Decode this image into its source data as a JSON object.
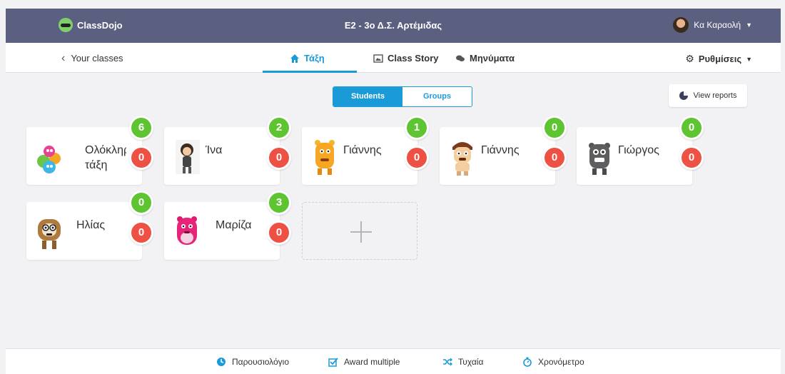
{
  "header": {
    "logo_text": "ClassDojo",
    "class_title": "E2 - 3ο Δ.Σ. Αρτέμιδας",
    "user_name": "Κα Καραολή"
  },
  "nav": {
    "back_label": "Your classes",
    "tabs": [
      {
        "label": "Τάξη",
        "icon": "home-icon",
        "active": true
      },
      {
        "label": "Class Story",
        "icon": "image-icon",
        "active": false
      },
      {
        "label": "Μηνύματα",
        "icon": "chat-icon",
        "active": false
      }
    ],
    "settings_label": "Ρυθμίσεις"
  },
  "view_toggle": {
    "students": "Students",
    "groups": "Groups",
    "selected": "Students"
  },
  "reports_label": "View reports",
  "students": [
    {
      "name": "Ολόκληρη τάξη",
      "positive": "6",
      "negative": "0"
    },
    {
      "name": "Ίνα",
      "positive": "2",
      "negative": "0"
    },
    {
      "name": "Γιάννης",
      "positive": "1",
      "negative": "0"
    },
    {
      "name": "Γιάννης",
      "positive": "0",
      "negative": "0"
    },
    {
      "name": "Γιώργος",
      "positive": "0",
      "negative": "0"
    },
    {
      "name": "Ηλίας",
      "positive": "0",
      "negative": "0"
    },
    {
      "name": "Μαρίζα",
      "positive": "3",
      "negative": "0"
    }
  ],
  "footer": {
    "attendance": "Παρουσιολόγιο",
    "award_multiple": "Award multiple",
    "random": "Τυχαία",
    "timer": "Χρονόμετρο"
  },
  "colors": {
    "accent": "#1a9bd7",
    "topbar": "#5b5f80",
    "positive": "#5fc431",
    "negative": "#ee5043"
  }
}
